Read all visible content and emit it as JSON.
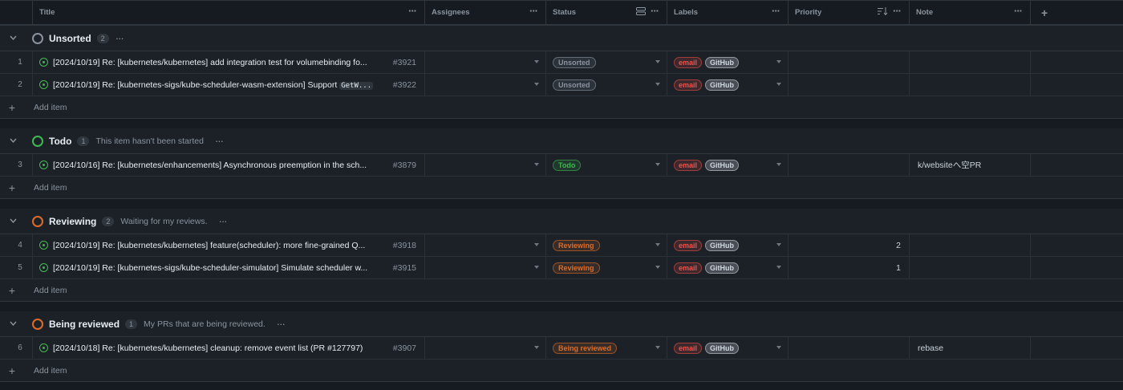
{
  "header": {
    "columns": {
      "title": "Title",
      "assignees": "Assignees",
      "status": "Status",
      "labels": "Labels",
      "priority": "Priority",
      "note": "Note"
    },
    "add_column": "+"
  },
  "more_glyph": "···",
  "add_item_label": "Add item",
  "colors": {
    "unsorted": "#8b949e",
    "todo": "#3fb950",
    "reviewing": "#db6d28",
    "being_reviewed": "#db6d28",
    "email_label": "#f85149",
    "github_label": "#d0d7de"
  },
  "groups": [
    {
      "name": "Unsorted",
      "count": "2",
      "description": "",
      "color": "#8b949e",
      "items": [
        {
          "num": "1",
          "title": "[2024/10/19] Re: [kubernetes/kubernetes] add integration test for volumebinding fo...",
          "code": "",
          "issue": "#3921",
          "status": "Unsorted",
          "labels": [
            "email",
            "GitHub"
          ],
          "priority": "",
          "note": ""
        },
        {
          "num": "2",
          "title": "[2024/10/19] Re: [kubernetes-sigs/kube-scheduler-wasm-extension] Support ",
          "code": "GetW...",
          "issue": "#3922",
          "status": "Unsorted",
          "labels": [
            "email",
            "GitHub"
          ],
          "priority": "",
          "note": ""
        }
      ]
    },
    {
      "name": "Todo",
      "count": "1",
      "description": "This item hasn't been started",
      "color": "#3fb950",
      "items": [
        {
          "num": "3",
          "title": "[2024/10/16] Re: [kubernetes/enhancements] Asynchronous preemption in the sch...",
          "code": "",
          "issue": "#3879",
          "status": "Todo",
          "labels": [
            "email",
            "GitHub"
          ],
          "priority": "",
          "note": "k/websiteへ空PR"
        }
      ]
    },
    {
      "name": "Reviewing",
      "count": "2",
      "description": "Waiting for my reviews.",
      "color": "#db6d28",
      "items": [
        {
          "num": "4",
          "title": "[2024/10/19] Re: [kubernetes/kubernetes] feature(scheduler): more fine-grained Q...",
          "code": "",
          "issue": "#3918",
          "status": "Reviewing",
          "labels": [
            "email",
            "GitHub"
          ],
          "priority": "2",
          "note": ""
        },
        {
          "num": "5",
          "title": "[2024/10/19] Re: [kubernetes-sigs/kube-scheduler-simulator] Simulate scheduler w...",
          "code": "",
          "issue": "#3915",
          "status": "Reviewing",
          "labels": [
            "email",
            "GitHub"
          ],
          "priority": "1",
          "note": ""
        }
      ]
    },
    {
      "name": "Being reviewed",
      "count": "1",
      "description": "My PRs that are being reviewed.",
      "color": "#db6d28",
      "items": [
        {
          "num": "6",
          "title": "[2024/10/18] Re: [kubernetes/kubernetes] cleanup: remove event list (PR #127797)",
          "code": "",
          "issue": "#3907",
          "status": "Being reviewed",
          "labels": [
            "email",
            "GitHub"
          ],
          "priority": "",
          "note": "rebase"
        }
      ]
    }
  ]
}
